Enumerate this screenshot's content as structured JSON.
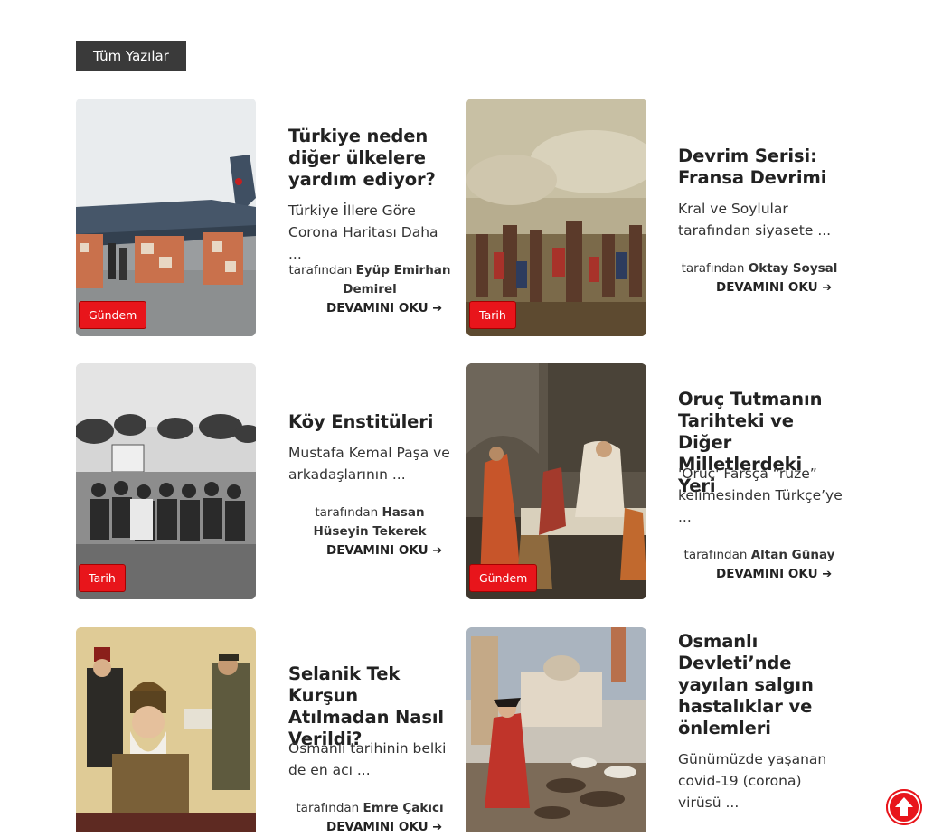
{
  "section": {
    "label": "Tüm Yazılar"
  },
  "byline_prefix": "tarafından",
  "read_more": "DEVAMINI OKU",
  "posts": [
    {
      "title": "Türkiye neden diğer ülkelere yardım ediyor?",
      "excerpt": "Türkiye İllere Göre Corona Haritası Daha ...",
      "author": "Eyüp Emirhan Demirel",
      "category": "Gündem"
    },
    {
      "title": "Devrim Serisi: Fransa Devrimi",
      "excerpt": "Kral ve Soylular tarafından siyasete ...",
      "author": "Oktay Soysal",
      "category": "Tarih"
    },
    {
      "title": "Köy Enstitüleri",
      "excerpt": "Mustafa Kemal Paşa ve arkadaşlarının ...",
      "author": "Hasan Hüseyin Tekerek",
      "category": "Tarih"
    },
    {
      "title": "Oruç Tutmanın Tarihteki ve Diğer Milletlerdeki Yeri",
      "excerpt": "'Oruç' Farsça “ruze” kelimesinden Türkçe’ye ...",
      "author": "Altan Günay",
      "category": "Gündem"
    },
    {
      "title": "Selanik Tek Kurşun Atılmadan Nasıl Verildi?",
      "excerpt": "Osmanlı tarihinin belki de en acı ...",
      "author": "Emre Çakıcı",
      "category": ""
    },
    {
      "title": "Osmanlı Devleti’nde yayılan salgın hastalıklar ve önlemleri",
      "excerpt": "Günümüzde yaşanan covid-19 (corona) virüsü ...",
      "author": "",
      "category": ""
    }
  ],
  "colors": {
    "accent": "#e8151b",
    "tag_bg": "#3a3a3a"
  },
  "icons": {
    "scroll_top": "arrow-up-circle-icon",
    "read_more_arrow": "arrow-right-icon"
  }
}
